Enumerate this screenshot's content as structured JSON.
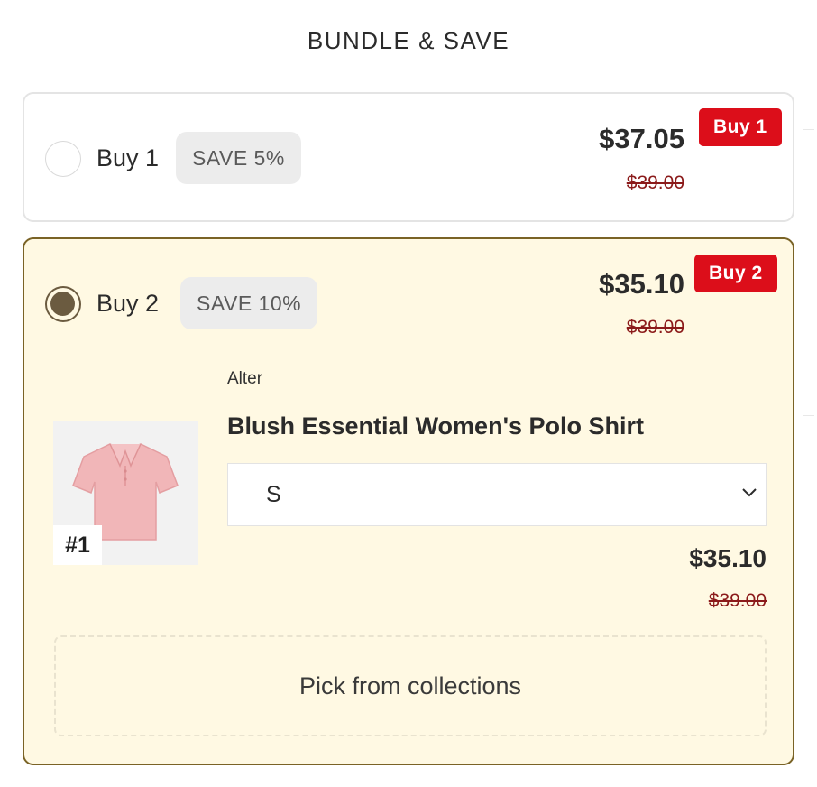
{
  "header": {
    "title": "BUNDLE & SAVE"
  },
  "bundles": [
    {
      "label": "Buy 1",
      "save_label": "SAVE 5%",
      "price": "$37.05",
      "compare_price": "$39.00",
      "badge": "Buy 1",
      "selected": false
    },
    {
      "label": "Buy 2",
      "save_label": "SAVE 10%",
      "price": "$35.10",
      "compare_price": "$39.00",
      "badge": "Buy 2",
      "selected": true,
      "item": {
        "brand": "Alter",
        "name": "Blush Essential Women's Polo Shirt",
        "number_badge": "#1",
        "size_value": "S",
        "price": "$35.10",
        "compare_price": "$39.00"
      },
      "pick_label": "Pick from collections"
    }
  ],
  "colors": {
    "badge_red": "#dc0e1a",
    "selected_border": "#7a6326",
    "selected_bg": "#fff9e3",
    "strike_price": "#8b1a1a"
  },
  "icons": [
    "radio-unselected-icon",
    "radio-selected-icon",
    "chevron-down-icon"
  ]
}
